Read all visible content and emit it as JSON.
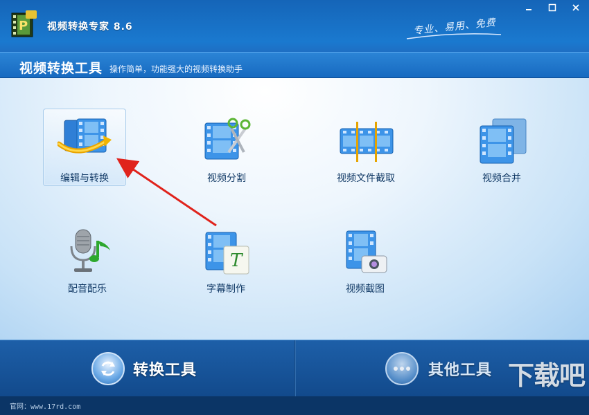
{
  "window": {
    "title": "视频转换专家 8.6",
    "slogan": "专业、易用、免费",
    "buttons": {
      "minimize": "minimize-icon",
      "maximize": "maximize-icon",
      "close": "close-icon"
    }
  },
  "header": {
    "title": "视频转换工具",
    "subtitle": "操作简单，功能强大的视频转换助手"
  },
  "tools": [
    {
      "label": "编辑与转换",
      "icon": "edit-convert-icon",
      "selected": true
    },
    {
      "label": "视频分割",
      "icon": "video-split-icon",
      "selected": false
    },
    {
      "label": "视频文件截取",
      "icon": "video-clip-icon",
      "selected": false
    },
    {
      "label": "视频合并",
      "icon": "video-merge-icon",
      "selected": false
    },
    {
      "label": "配音配乐",
      "icon": "dubbing-music-icon",
      "selected": false
    },
    {
      "label": "字幕制作",
      "icon": "subtitle-icon",
      "selected": false
    },
    {
      "label": "视频截图",
      "icon": "screenshot-icon",
      "selected": false
    }
  ],
  "bottom_tabs": [
    {
      "label": "转换工具",
      "icon": "refresh-icon",
      "active": true
    },
    {
      "label": "其他工具",
      "icon": "more-icon",
      "active": false
    }
  ],
  "footer": {
    "text": "官网：www.17rd.com"
  },
  "watermark": "下载吧",
  "colors": {
    "accent": "#1a79cf",
    "panel": "#d6eaf9",
    "arrow": "#e0231c"
  }
}
